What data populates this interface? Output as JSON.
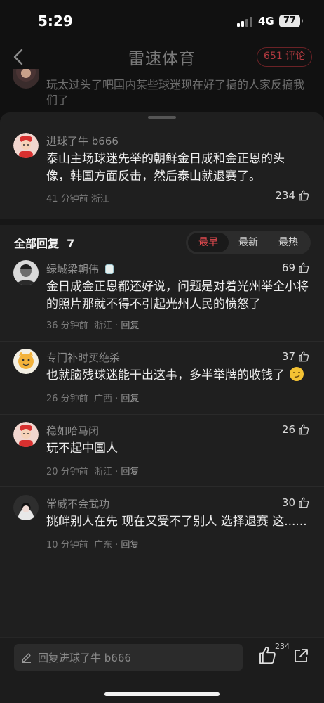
{
  "status": {
    "time": "5:29",
    "network": "4G",
    "battery": "77"
  },
  "header": {
    "title": "雷速体育",
    "comment_count": "651 评论"
  },
  "background_comment": {
    "text": "玩太过头了吧国内某些球迷现在好了搞的人家反搞我们了"
  },
  "main_comment": {
    "username": "进球了牛 b666",
    "text": "泰山主场球迷先举的朝鲜金日成和金正恩的头像，韩国方面反击，然后泰山就退赛了。",
    "meta": "41 分钟前 浙江",
    "likes": "234"
  },
  "replies_header": {
    "label": "全部回复",
    "count": "7",
    "sort_options": [
      "最早",
      "最新",
      "最热"
    ],
    "active_sort": "最早"
  },
  "replies": [
    {
      "username": "绿城梁朝伟",
      "text": "金日成金正恩都还好说，问题是对着光州举全小将的照片那就不得不引起光州人民的愤怒了",
      "time": "36 分钟前",
      "region": "浙江",
      "reply": "回复",
      "likes": "69"
    },
    {
      "username": "专门补时买绝杀",
      "text": "也就脑残球迷能干出这事，多半举牌的收钱了",
      "time": "26 分钟前",
      "region": "广西",
      "reply": "回复",
      "likes": "37"
    },
    {
      "username": "稳如哈马闭",
      "text": "玩不起中国人",
      "time": "20 分钟前",
      "region": "浙江",
      "reply": "回复",
      "likes": "26"
    },
    {
      "username": "常威不会武功",
      "text": "挑衅别人在先 现在又受不了别人 选择退赛 这......",
      "time": "10 分钟前",
      "region": "广东",
      "reply": "回复",
      "likes": "30"
    }
  ],
  "bottom_bar": {
    "placeholder": "回复进球了牛 b666",
    "like_count": "234"
  },
  "colors": {
    "accent": "#e24a4f",
    "background": "#111111",
    "sheet": "#1f1f1f"
  }
}
